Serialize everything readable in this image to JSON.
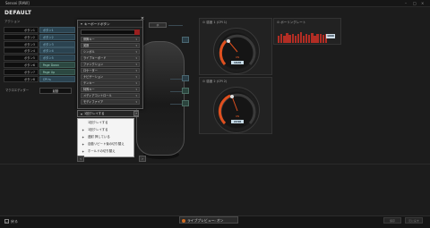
{
  "window": {
    "title": "Sensei [RAW]",
    "controls": [
      "–",
      "□",
      "×"
    ]
  },
  "header": {
    "profile": "DEFAULT",
    "actions_label": "アクション"
  },
  "buttons": [
    {
      "name": "ボタン1",
      "binding": "ボタン1",
      "color": "blue"
    },
    {
      "name": "ボタン2",
      "binding": "ボタン2",
      "color": "blue"
    },
    {
      "name": "ボタン3",
      "binding": "ボタン3",
      "color": "blue"
    },
    {
      "name": "ボタン4",
      "binding": "ボタン4",
      "color": "blue"
    },
    {
      "name": "ボタン5",
      "binding": "ボタン5",
      "color": "blue"
    },
    {
      "name": "ボタン6",
      "binding": "Page Down",
      "color": "green"
    },
    {
      "name": "ボタン7",
      "binding": "Page Up",
      "color": "green"
    },
    {
      "name": "ボタン8",
      "binding": "CPI ⇆",
      "color": "blue"
    }
  ],
  "macro": {
    "label": "マクロエディター",
    "button": "起動"
  },
  "key_popup": {
    "title": "キーボードボタン",
    "categories": [
      "修飾キー",
      "英数",
      "シンボル",
      "ライブキーボード",
      "ファンクション",
      "ロケーター",
      "ナビゲーション",
      "テンキー",
      "特殊キー",
      "メディアコントロール",
      "モディファイア"
    ]
  },
  "dropdown": {
    "selected": "1回クレイする",
    "arrow": "?"
  },
  "menu_items": [
    {
      "label": "1回クレイする",
      "icon": ""
    },
    {
      "label": "1回クレイする",
      "icon": "✦"
    },
    {
      "label": "連射 押している",
      "icon": "✦"
    },
    {
      "label": "自動リピート後の切り替え",
      "icon": "✦"
    },
    {
      "label": "ホールドの切り替え",
      "icon": "✦"
    }
  ],
  "small_button": "ホ",
  "panels": {
    "cpi1": {
      "title": "感度 1 (CPI 1)",
      "value": "1620",
      "on": "ON"
    },
    "cpi2": {
      "title": "感度 2 (CPI 2)",
      "value": "2240",
      "on": "ON"
    },
    "polling": {
      "title": "ポーリングレート",
      "value": "1000"
    }
  },
  "polling_bars": [
    0.55,
    0.7,
    0.6,
    0.8,
    0.65,
    0.75,
    0.6,
    0.7,
    0.85,
    0.6,
    0.7,
    0.65,
    0.8,
    0.6,
    0.7,
    0.75,
    0.65,
    0.7
  ],
  "bottom": {
    "back": "戻る",
    "preview": "ライブプレビュー: オン",
    "btn1": "保存",
    "btn2": "元に戻す"
  },
  "colors": {
    "accent": "#e0501f",
    "bind_blue": "#2b4350",
    "bind_green": "#2c4841",
    "bar_red": "#b22d24"
  }
}
